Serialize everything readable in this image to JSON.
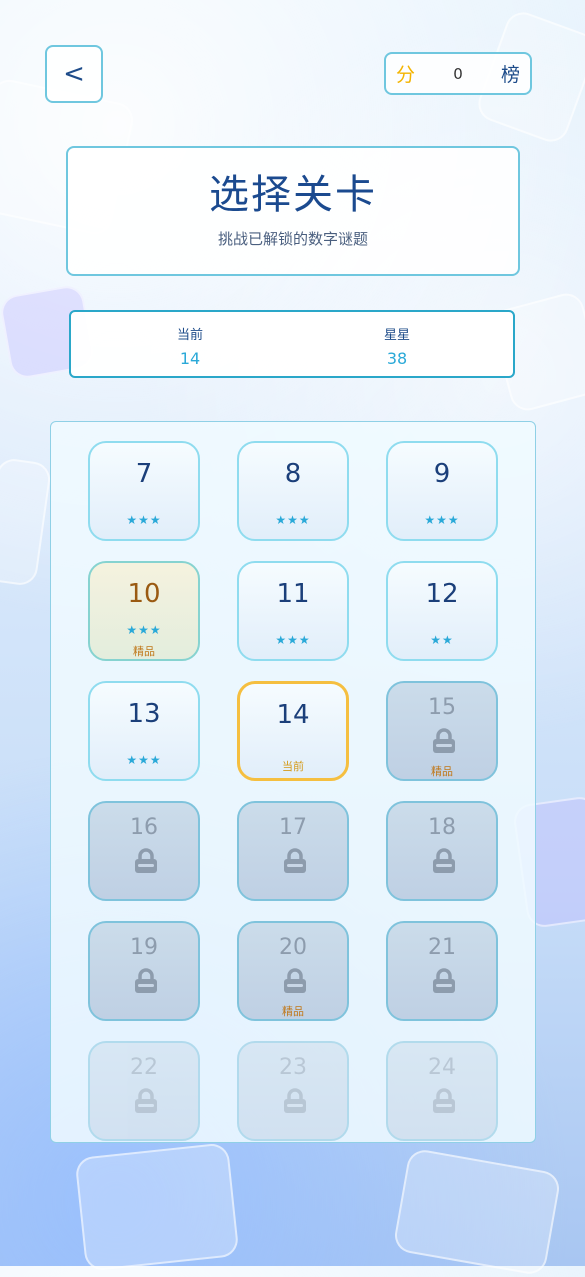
{
  "header": {
    "back_label": "<",
    "score_label": "分",
    "score_value": "0",
    "rank_label": "榜"
  },
  "title_card": {
    "title": "选择关卡",
    "subtitle": "挑战已解锁的数字谜题"
  },
  "stats": {
    "current_label": "当前",
    "current_value": "14",
    "stars_label": "星星",
    "stars_value": "38"
  },
  "levels": [
    {
      "num": "7",
      "stars": "★★★",
      "tag": "",
      "state": "done"
    },
    {
      "num": "8",
      "stars": "★★★",
      "tag": "",
      "state": "done"
    },
    {
      "num": "9",
      "stars": "★★★",
      "tag": "",
      "state": "done"
    },
    {
      "num": "10",
      "stars": "★★★",
      "tag": "精品",
      "state": "premium"
    },
    {
      "num": "11",
      "stars": "★★★",
      "tag": "",
      "state": "done"
    },
    {
      "num": "12",
      "stars": "★★",
      "tag": "",
      "state": "done"
    },
    {
      "num": "13",
      "stars": "★★★",
      "tag": "",
      "state": "done"
    },
    {
      "num": "14",
      "stars": "",
      "tag": "当前",
      "state": "current"
    },
    {
      "num": "15",
      "stars": "",
      "tag": "精品",
      "state": "locked"
    },
    {
      "num": "16",
      "stars": "",
      "tag": "",
      "state": "locked"
    },
    {
      "num": "17",
      "stars": "",
      "tag": "",
      "state": "locked"
    },
    {
      "num": "18",
      "stars": "",
      "tag": "",
      "state": "locked"
    },
    {
      "num": "19",
      "stars": "",
      "tag": "",
      "state": "locked"
    },
    {
      "num": "20",
      "stars": "",
      "tag": "精品",
      "state": "locked"
    },
    {
      "num": "21",
      "stars": "",
      "tag": "",
      "state": "locked"
    },
    {
      "num": "22",
      "stars": "",
      "tag": "",
      "state": "locked"
    },
    {
      "num": "23",
      "stars": "",
      "tag": "",
      "state": "locked"
    },
    {
      "num": "24",
      "stars": "",
      "tag": "",
      "state": "locked"
    }
  ],
  "colors": {
    "accent": "#2aa9d8",
    "current_border": "#f5bf40",
    "premium_tag": "#c0781a",
    "title": "#1b4a8f"
  }
}
